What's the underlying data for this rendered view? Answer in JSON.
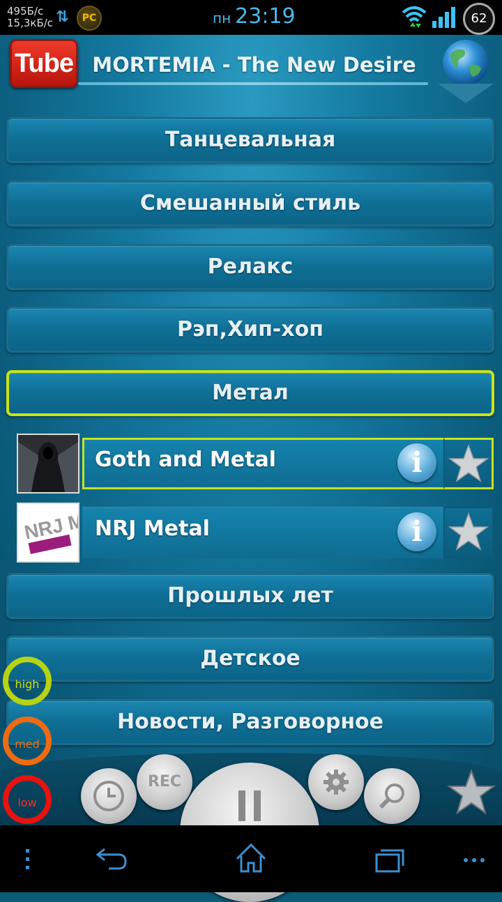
{
  "status_bar": {
    "net_down": "495Б/с",
    "net_up": "15,3кБ/с",
    "pc_badge": "PC",
    "day": "пн",
    "time": "23:19",
    "battery": "62"
  },
  "header": {
    "logo_text": "Tube",
    "now_playing": "MORTEMIA - The New Desire",
    "globe_icon": "globe-icon"
  },
  "categories_top": [
    {
      "label": "Танцевальная"
    },
    {
      "label": "Смешанный стиль"
    },
    {
      "label": "Релакс"
    },
    {
      "label": "Рэп,Хип-хоп"
    },
    {
      "label": "Метал",
      "active": true
    }
  ],
  "stations": [
    {
      "name": "Goth and Metal",
      "active": true,
      "info_label": "i"
    },
    {
      "name": "NRJ Metal",
      "active": false,
      "info_label": "i",
      "thumb_text": "NRJ METAL"
    }
  ],
  "categories_bottom": [
    {
      "label": "Прошлых лет"
    },
    {
      "label": "Детское"
    },
    {
      "label": "Новости, Разговорное"
    }
  ],
  "quality": {
    "high": "high",
    "med": "med",
    "low": "low"
  },
  "controls": {
    "rec_label": "REC"
  },
  "colors": {
    "accent_active": "#c7e31a",
    "button_bg": "#1479a0",
    "quality_high": "#b6d316",
    "quality_med": "#f06a12",
    "quality_low": "#e8120e"
  }
}
